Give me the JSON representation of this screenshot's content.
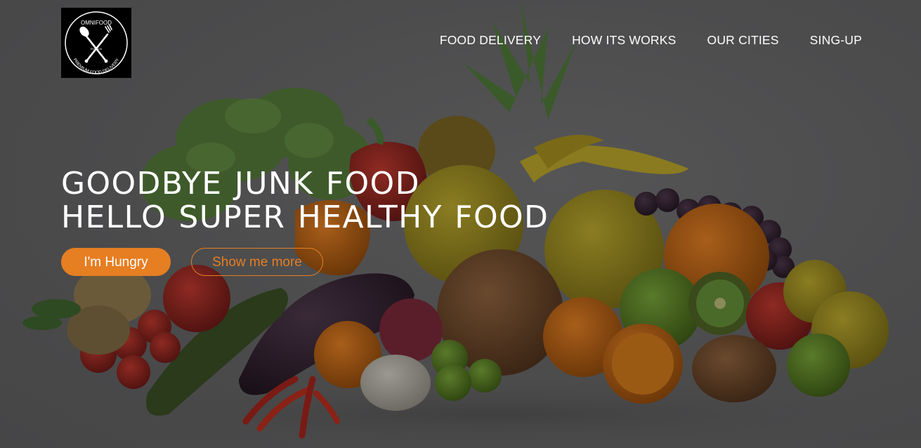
{
  "brand": {
    "logo_top_text": "OMNIFOOD",
    "logo_bottom_text": "PREMIUM FOOD DELIVERY",
    "logo_est": "EST. 2015"
  },
  "nav": {
    "items": [
      {
        "label": "FOOD DELIVERY"
      },
      {
        "label": "HOW ITS WORKS"
      },
      {
        "label": "OUR CITIES"
      },
      {
        "label": "SING-UP"
      }
    ]
  },
  "hero": {
    "headline_line1": "GOODBYE JUNK FOOD",
    "headline_line2": "HELLO SUPER HEALTHY FOOD",
    "primary_button": "I'm Hungry",
    "secondary_button": "Show me more",
    "background_image": "fruits-and-vegetables-pile"
  },
  "colors": {
    "accent": "#e67e22",
    "text": "#ffffff",
    "background": "#4a4a4b"
  }
}
